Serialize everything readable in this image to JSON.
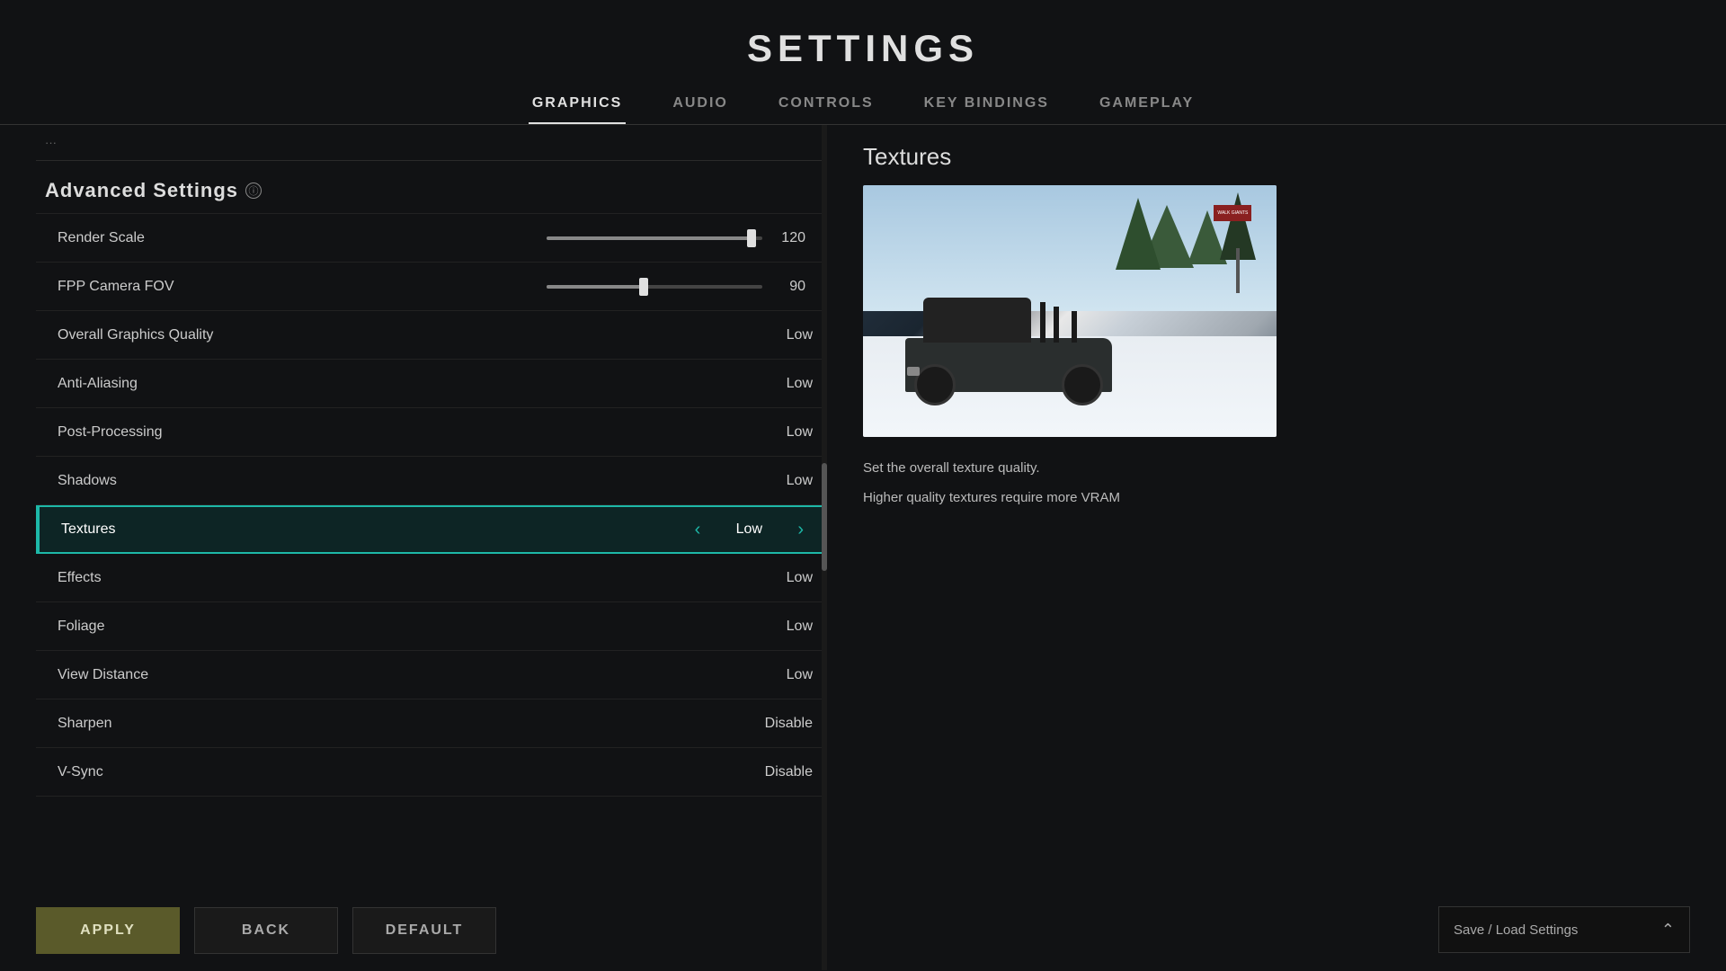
{
  "page": {
    "title": "SETTINGS"
  },
  "tabs": [
    {
      "id": "graphics",
      "label": "GRAPHICS",
      "active": true
    },
    {
      "id": "audio",
      "label": "AUDIO",
      "active": false
    },
    {
      "id": "controls",
      "label": "CONTROLS",
      "active": false
    },
    {
      "id": "keybindings",
      "label": "KEY BINDINGS",
      "active": false
    },
    {
      "id": "gameplay",
      "label": "GAMEPLAY",
      "active": false
    }
  ],
  "advanced_settings": {
    "header": "Advanced Settings",
    "info_icon": "ⓘ",
    "rows": [
      {
        "id": "render-scale",
        "name": "Render Scale",
        "type": "slider",
        "value": "120",
        "fill_percent": 95
      },
      {
        "id": "fpp-camera-fov",
        "name": "FPP Camera FOV",
        "type": "slider",
        "value": "90",
        "fill_percent": 45
      },
      {
        "id": "overall-graphics",
        "name": "Overall Graphics Quality",
        "type": "select",
        "value": "Low",
        "active": false
      },
      {
        "id": "anti-aliasing",
        "name": "Anti-Aliasing",
        "type": "select",
        "value": "Low",
        "active": false
      },
      {
        "id": "post-processing",
        "name": "Post-Processing",
        "type": "select",
        "value": "Low",
        "active": false
      },
      {
        "id": "shadows",
        "name": "Shadows",
        "type": "select",
        "value": "Low",
        "active": false
      },
      {
        "id": "textures",
        "name": "Textures",
        "type": "select",
        "value": "Low",
        "active": true
      },
      {
        "id": "effects",
        "name": "Effects",
        "type": "select",
        "value": "Low",
        "active": false
      },
      {
        "id": "foliage",
        "name": "Foliage",
        "type": "select",
        "value": "Low",
        "active": false
      },
      {
        "id": "view-distance",
        "name": "View Distance",
        "type": "select",
        "value": "Low",
        "active": false
      },
      {
        "id": "sharpen",
        "name": "Sharpen",
        "type": "select",
        "value": "Disable",
        "active": false
      },
      {
        "id": "vsync",
        "name": "V-Sync",
        "type": "select",
        "value": "Disable",
        "active": false
      }
    ]
  },
  "preview_panel": {
    "title": "Textures",
    "description1": "Set the overall texture quality.",
    "description2": "Higher quality textures require more VRAM"
  },
  "bottom_bar": {
    "apply_label": "APPLY",
    "back_label": "BACK",
    "default_label": "DEFAULT",
    "save_load_label": "Save / Load Settings"
  }
}
